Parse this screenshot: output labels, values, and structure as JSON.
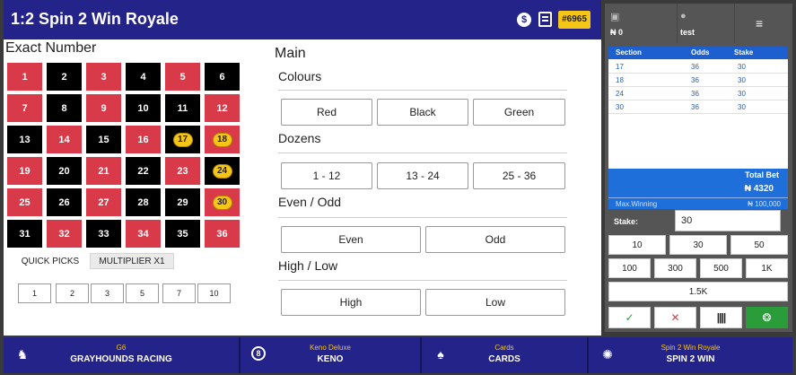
{
  "header": {
    "title": "1:2 Spin 2 Win Royale",
    "ticket_id": "#6965",
    "icons": [
      "dollar-icon",
      "calendar-icon"
    ]
  },
  "exact_number": {
    "title": "Exact Number",
    "cells": [
      {
        "n": "1",
        "color": "red",
        "chip": false
      },
      {
        "n": "2",
        "color": "black",
        "chip": false
      },
      {
        "n": "3",
        "color": "red",
        "chip": false
      },
      {
        "n": "4",
        "color": "black",
        "chip": false
      },
      {
        "n": "5",
        "color": "red",
        "chip": false
      },
      {
        "n": "6",
        "color": "black",
        "chip": false
      },
      {
        "n": "7",
        "color": "red",
        "chip": false
      },
      {
        "n": "8",
        "color": "black",
        "chip": false
      },
      {
        "n": "9",
        "color": "red",
        "chip": false
      },
      {
        "n": "10",
        "color": "black",
        "chip": false
      },
      {
        "n": "11",
        "color": "black",
        "chip": false
      },
      {
        "n": "12",
        "color": "red",
        "chip": false
      },
      {
        "n": "13",
        "color": "black",
        "chip": false
      },
      {
        "n": "14",
        "color": "red",
        "chip": false
      },
      {
        "n": "15",
        "color": "black",
        "chip": false
      },
      {
        "n": "16",
        "color": "red",
        "chip": false
      },
      {
        "n": "17",
        "color": "black",
        "chip": true
      },
      {
        "n": "18",
        "color": "red",
        "chip": true
      },
      {
        "n": "19",
        "color": "red",
        "chip": false
      },
      {
        "n": "20",
        "color": "black",
        "chip": false
      },
      {
        "n": "21",
        "color": "red",
        "chip": false
      },
      {
        "n": "22",
        "color": "black",
        "chip": false
      },
      {
        "n": "23",
        "color": "red",
        "chip": false
      },
      {
        "n": "24",
        "color": "black",
        "chip": true
      },
      {
        "n": "25",
        "color": "red",
        "chip": false
      },
      {
        "n": "26",
        "color": "black",
        "chip": false
      },
      {
        "n": "27",
        "color": "red",
        "chip": false
      },
      {
        "n": "28",
        "color": "black",
        "chip": false
      },
      {
        "n": "29",
        "color": "black",
        "chip": false
      },
      {
        "n": "30",
        "color": "red",
        "chip": true
      },
      {
        "n": "31",
        "color": "black",
        "chip": false
      },
      {
        "n": "32",
        "color": "red",
        "chip": false
      },
      {
        "n": "33",
        "color": "black",
        "chip": false
      },
      {
        "n": "34",
        "color": "red",
        "chip": false
      },
      {
        "n": "35",
        "color": "black",
        "chip": false
      },
      {
        "n": "36",
        "color": "red",
        "chip": false
      }
    ],
    "tabs": [
      "QUICK PICKS",
      "MULTIPLIER X1"
    ],
    "quick_picks": [
      "1",
      "2",
      "3",
      "5",
      "7",
      "10"
    ]
  },
  "main": {
    "title": "Main",
    "colours": {
      "title": "Colours",
      "options": [
        "Red",
        "Black",
        "Green"
      ]
    },
    "dozens": {
      "title": "Dozens",
      "options": [
        "1 - 12",
        "13 - 24",
        "25 - 36"
      ]
    },
    "even_odd": {
      "title": "Even / Odd",
      "options": [
        "Even",
        "Odd"
      ]
    },
    "high_low": {
      "title": "High / Low",
      "options": [
        "High",
        "Low"
      ]
    }
  },
  "side": {
    "balance": "₦ 0",
    "user": "test",
    "menu_icon": "hamburger-menu-icon",
    "table": {
      "headers": [
        "Section",
        "Odds",
        "Stake"
      ],
      "rows": [
        [
          "17",
          "36",
          "30"
        ],
        [
          "18",
          "36",
          "30"
        ],
        [
          "24",
          "36",
          "30"
        ],
        [
          "30",
          "36",
          "30"
        ]
      ]
    },
    "total_bet_label": "Total Bet",
    "total_bet_value": "₦ 4320",
    "max_winning_label": "Max.Winning",
    "max_winning_value": "₦ 100,000",
    "stake_label": "Stake:",
    "stake_value": "30",
    "chips": [
      "10",
      "30",
      "50",
      "100",
      "300",
      "500",
      "1K",
      "1.5K"
    ],
    "actions": {
      "ok": "✓",
      "cancel": "✕",
      "barcode": "||||",
      "print": "❂"
    }
  },
  "bottom_nav": [
    {
      "game": "G6",
      "name": "GRAYHOUNDS RACING",
      "icon": "greyhound-icon"
    },
    {
      "game": "Keno Deluxe",
      "name": "KENO",
      "icon": "keno-ball-icon"
    },
    {
      "game": "Cards",
      "name": "CARDS",
      "icon": "cards-icon"
    },
    {
      "game": "Spin 2 Win Royale",
      "name": "SPIN 2 WIN",
      "icon": "wheel-icon"
    }
  ],
  "colors": {
    "header_bg": "#23238a",
    "red": "#d93a4a",
    "black": "#000000",
    "chip": "#f5c518",
    "accent_blue": "#1e6fd9",
    "green": "#2a9d3a"
  }
}
